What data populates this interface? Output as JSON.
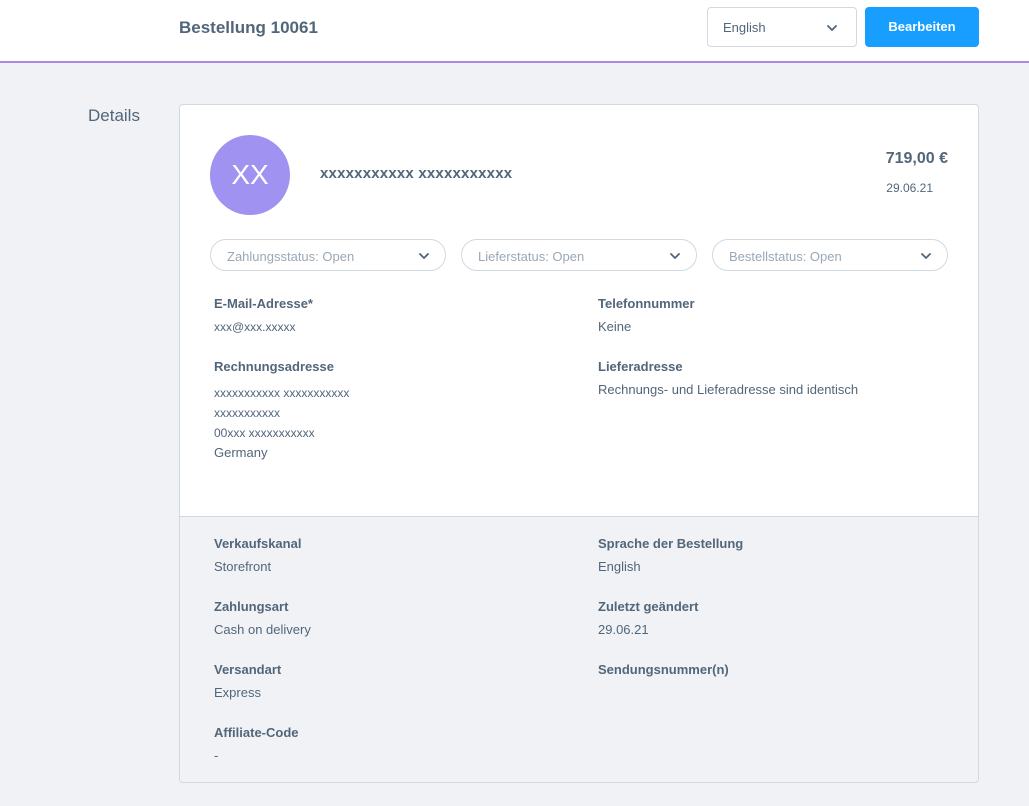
{
  "header": {
    "title": "Bestellung 10061",
    "language_value": "English",
    "edit_label": "Bearbeiten"
  },
  "section_label": "Details",
  "customer": {
    "initials": "XX",
    "name": "xxxxxxxxxxx xxxxxxxxxxx",
    "total": "719,00 €",
    "date": "29.06.21"
  },
  "status": {
    "payment": "Zahlungsstatus: Open",
    "delivery": "Lieferstatus: Open",
    "order": "Bestellstatus: Open"
  },
  "details": {
    "email_label": "E-Mail-Adresse*",
    "email_value": "xxx@xxx.xxxxx",
    "phone_label": "Telefonnummer",
    "phone_value": "Keine",
    "billing_label": "Rechnungsadresse",
    "billing_lines": [
      "xxxxxxxxxxx xxxxxxxxxxx",
      "xxxxxxxxxxx",
      "00xxx xxxxxxxxxxx",
      "Germany"
    ],
    "shipping_label": "Lieferadresse",
    "shipping_value": "Rechnungs- und Lieferadresse sind identisch"
  },
  "meta": {
    "channel_label": "Verkaufskanal",
    "channel_value": "Storefront",
    "order_language_label": "Sprache der Bestellung",
    "order_language_value": "English",
    "payment_method_label": "Zahlungsart",
    "payment_method_value": "Cash on delivery",
    "last_changed_label": "Zuletzt geändert",
    "last_changed_value": "29.06.21",
    "shipping_method_label": "Versandart",
    "shipping_method_value": "Express",
    "tracking_label": "Sendungsnummer(n)",
    "affiliate_label": "Affiliate-Code",
    "affiliate_value": "-"
  },
  "colors": {
    "accent": "#189eff",
    "avatar": "#a092f0",
    "topbar_border": "#a88ae0",
    "text": "#52667a"
  }
}
